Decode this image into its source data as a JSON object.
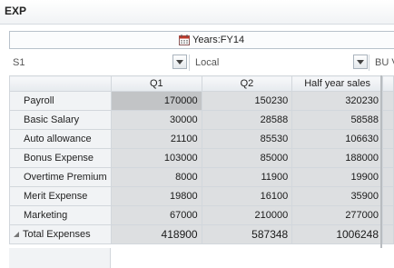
{
  "window": {
    "title": "EXP"
  },
  "pov": {
    "label": "Years:FY14",
    "icon": "calendar-icon"
  },
  "dropdowns": [
    {
      "value": "S1"
    },
    {
      "value": "Local"
    },
    {
      "value": "BU V"
    }
  ],
  "grid": {
    "columns": [
      "Q1",
      "Q2",
      "Half year sales"
    ],
    "rows": [
      {
        "label": "Payroll",
        "values": [
          "170000",
          "150230",
          "320230"
        ]
      },
      {
        "label": "Basic Salary",
        "values": [
          "30000",
          "28588",
          "58588"
        ]
      },
      {
        "label": "Auto allowance",
        "values": [
          "21100",
          "85530",
          "106630"
        ]
      },
      {
        "label": "Bonus Expense",
        "values": [
          "103000",
          "85000",
          "188000"
        ]
      },
      {
        "label": "Overtime Premium",
        "values": [
          "8000",
          "11900",
          "19900"
        ]
      },
      {
        "label": "Merit Expense",
        "values": [
          "19800",
          "16100",
          "35900"
        ]
      },
      {
        "label": "Marketing",
        "values": [
          "67000",
          "210000",
          "277000"
        ]
      }
    ],
    "total": {
      "label": "Total Expenses",
      "values": [
        "418900",
        "587348",
        "1006248"
      ]
    }
  },
  "colors": {
    "cell_bg": "#dddfe1",
    "selected_cell_bg": "#c2c4c6",
    "header_bg": "#e6eaee"
  }
}
